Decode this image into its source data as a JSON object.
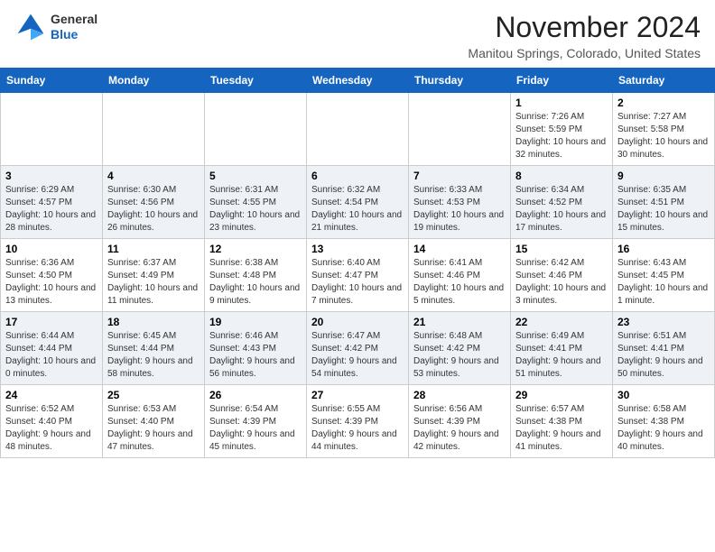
{
  "header": {
    "logo_line1": "General",
    "logo_line2": "Blue",
    "month": "November 2024",
    "location": "Manitou Springs, Colorado, United States"
  },
  "weekdays": [
    "Sunday",
    "Monday",
    "Tuesday",
    "Wednesday",
    "Thursday",
    "Friday",
    "Saturday"
  ],
  "weeks": [
    [
      {
        "day": "",
        "info": ""
      },
      {
        "day": "",
        "info": ""
      },
      {
        "day": "",
        "info": ""
      },
      {
        "day": "",
        "info": ""
      },
      {
        "day": "",
        "info": ""
      },
      {
        "day": "1",
        "info": "Sunrise: 7:26 AM\nSunset: 5:59 PM\nDaylight: 10 hours and 32 minutes."
      },
      {
        "day": "2",
        "info": "Sunrise: 7:27 AM\nSunset: 5:58 PM\nDaylight: 10 hours and 30 minutes."
      }
    ],
    [
      {
        "day": "3",
        "info": "Sunrise: 6:29 AM\nSunset: 4:57 PM\nDaylight: 10 hours and 28 minutes."
      },
      {
        "day": "4",
        "info": "Sunrise: 6:30 AM\nSunset: 4:56 PM\nDaylight: 10 hours and 26 minutes."
      },
      {
        "day": "5",
        "info": "Sunrise: 6:31 AM\nSunset: 4:55 PM\nDaylight: 10 hours and 23 minutes."
      },
      {
        "day": "6",
        "info": "Sunrise: 6:32 AM\nSunset: 4:54 PM\nDaylight: 10 hours and 21 minutes."
      },
      {
        "day": "7",
        "info": "Sunrise: 6:33 AM\nSunset: 4:53 PM\nDaylight: 10 hours and 19 minutes."
      },
      {
        "day": "8",
        "info": "Sunrise: 6:34 AM\nSunset: 4:52 PM\nDaylight: 10 hours and 17 minutes."
      },
      {
        "day": "9",
        "info": "Sunrise: 6:35 AM\nSunset: 4:51 PM\nDaylight: 10 hours and 15 minutes."
      }
    ],
    [
      {
        "day": "10",
        "info": "Sunrise: 6:36 AM\nSunset: 4:50 PM\nDaylight: 10 hours and 13 minutes."
      },
      {
        "day": "11",
        "info": "Sunrise: 6:37 AM\nSunset: 4:49 PM\nDaylight: 10 hours and 11 minutes."
      },
      {
        "day": "12",
        "info": "Sunrise: 6:38 AM\nSunset: 4:48 PM\nDaylight: 10 hours and 9 minutes."
      },
      {
        "day": "13",
        "info": "Sunrise: 6:40 AM\nSunset: 4:47 PM\nDaylight: 10 hours and 7 minutes."
      },
      {
        "day": "14",
        "info": "Sunrise: 6:41 AM\nSunset: 4:46 PM\nDaylight: 10 hours and 5 minutes."
      },
      {
        "day": "15",
        "info": "Sunrise: 6:42 AM\nSunset: 4:46 PM\nDaylight: 10 hours and 3 minutes."
      },
      {
        "day": "16",
        "info": "Sunrise: 6:43 AM\nSunset: 4:45 PM\nDaylight: 10 hours and 1 minute."
      }
    ],
    [
      {
        "day": "17",
        "info": "Sunrise: 6:44 AM\nSunset: 4:44 PM\nDaylight: 10 hours and 0 minutes."
      },
      {
        "day": "18",
        "info": "Sunrise: 6:45 AM\nSunset: 4:44 PM\nDaylight: 9 hours and 58 minutes."
      },
      {
        "day": "19",
        "info": "Sunrise: 6:46 AM\nSunset: 4:43 PM\nDaylight: 9 hours and 56 minutes."
      },
      {
        "day": "20",
        "info": "Sunrise: 6:47 AM\nSunset: 4:42 PM\nDaylight: 9 hours and 54 minutes."
      },
      {
        "day": "21",
        "info": "Sunrise: 6:48 AM\nSunset: 4:42 PM\nDaylight: 9 hours and 53 minutes."
      },
      {
        "day": "22",
        "info": "Sunrise: 6:49 AM\nSunset: 4:41 PM\nDaylight: 9 hours and 51 minutes."
      },
      {
        "day": "23",
        "info": "Sunrise: 6:51 AM\nSunset: 4:41 PM\nDaylight: 9 hours and 50 minutes."
      }
    ],
    [
      {
        "day": "24",
        "info": "Sunrise: 6:52 AM\nSunset: 4:40 PM\nDaylight: 9 hours and 48 minutes."
      },
      {
        "day": "25",
        "info": "Sunrise: 6:53 AM\nSunset: 4:40 PM\nDaylight: 9 hours and 47 minutes."
      },
      {
        "day": "26",
        "info": "Sunrise: 6:54 AM\nSunset: 4:39 PM\nDaylight: 9 hours and 45 minutes."
      },
      {
        "day": "27",
        "info": "Sunrise: 6:55 AM\nSunset: 4:39 PM\nDaylight: 9 hours and 44 minutes."
      },
      {
        "day": "28",
        "info": "Sunrise: 6:56 AM\nSunset: 4:39 PM\nDaylight: 9 hours and 42 minutes."
      },
      {
        "day": "29",
        "info": "Sunrise: 6:57 AM\nSunset: 4:38 PM\nDaylight: 9 hours and 41 minutes."
      },
      {
        "day": "30",
        "info": "Sunrise: 6:58 AM\nSunset: 4:38 PM\nDaylight: 9 hours and 40 minutes."
      }
    ]
  ]
}
